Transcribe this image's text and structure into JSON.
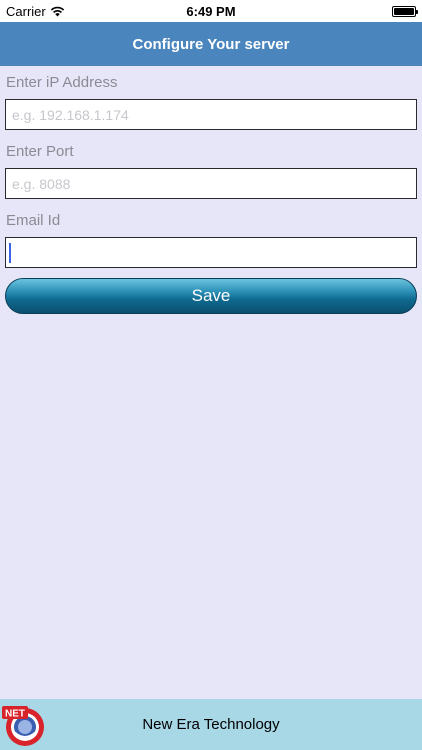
{
  "status_bar": {
    "carrier": "Carrier",
    "time": "6:49 PM"
  },
  "nav": {
    "title": "Configure Your server"
  },
  "form": {
    "ip_label": "Enter iP Address",
    "ip_placeholder": "e.g. 192.168.1.174",
    "ip_value": "",
    "port_label": "Enter Port",
    "port_placeholder": "e.g. 8088",
    "port_value": "",
    "email_label": "Email Id",
    "email_placeholder": "",
    "email_value": "",
    "save_label": "Save"
  },
  "footer": {
    "company": "New Era Technology",
    "logo_text": "NET"
  },
  "colors": {
    "nav_bg": "#4a86bd",
    "page_bg": "#e6e6f8",
    "footer_bg": "#a8d7e6",
    "logo_red": "#d8232a"
  },
  "icons": {
    "wifi": "wifi-icon",
    "battery": "battery-icon",
    "logo": "net-logo-icon"
  }
}
